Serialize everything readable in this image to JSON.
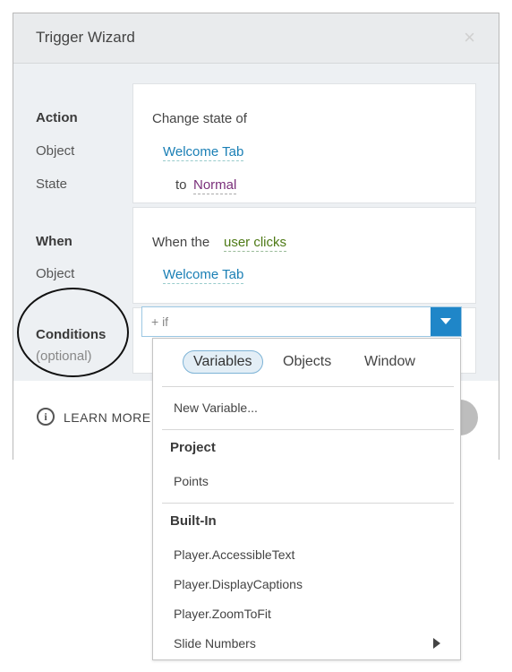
{
  "dialog": {
    "title": "Trigger Wizard",
    "close_glyph": "×"
  },
  "action_section": {
    "labels": [
      "Action",
      "Object",
      "State"
    ],
    "text": "Change state of",
    "object": "Welcome Tab",
    "to_text": "to",
    "state": "Normal"
  },
  "when_section": {
    "labels": [
      "When",
      "Object"
    ],
    "text_prefix": "When the",
    "event": "user clicks",
    "object": "Welcome Tab"
  },
  "conditions_section": {
    "label": "Conditions",
    "sublabel": "(optional)",
    "if_placeholder": "+ if"
  },
  "footer": {
    "info_glyph": "i",
    "learn_more": "LEARN MORE"
  },
  "dropdown": {
    "tabs": [
      "Variables",
      "Objects",
      "Window"
    ],
    "active_tab": "Variables",
    "new_variable": "New Variable...",
    "groups": [
      {
        "header": "Project",
        "items": [
          "Points"
        ]
      },
      {
        "header": "Built-In",
        "items": [
          "Player.AccessibleText",
          "Player.DisplayCaptions",
          "Player.ZoomToFit",
          "Slide Numbers"
        ]
      }
    ]
  },
  "colors": {
    "accent": "#1f86c8",
    "link_blue": "#1a7fb5",
    "link_purple": "#7a2f7a",
    "link_green": "#4e7a16",
    "header_bg": "#e9ebed",
    "body_bg": "#edf0f3"
  }
}
